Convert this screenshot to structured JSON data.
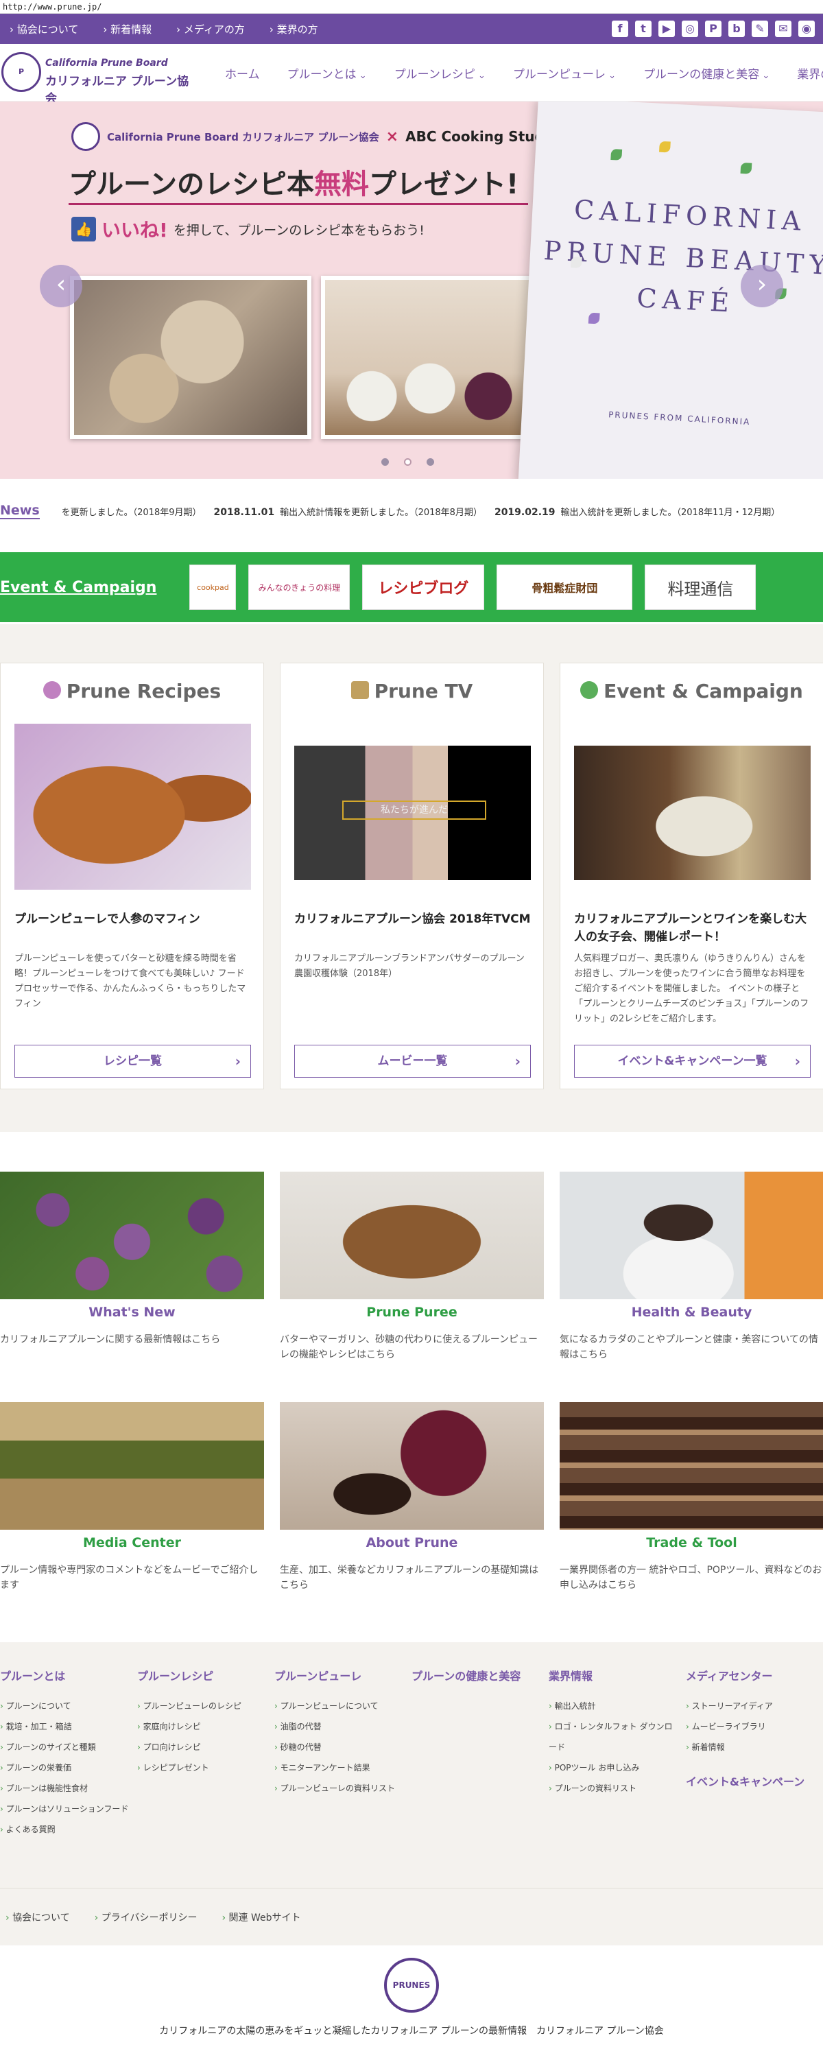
{
  "browser": {
    "url": "http://www.prune.jp/"
  },
  "topbar": {
    "links": [
      "協会について",
      "新着情報",
      "メディアの方",
      "業界の方"
    ],
    "social_icons": [
      "facebook-icon",
      "twitter-icon",
      "youtube-icon",
      "instagram-icon",
      "pinterest-icon",
      "blog-icon",
      "pen-icon",
      "mail-icon",
      "rss-icon"
    ]
  },
  "header": {
    "logo_line1": "California Prune Board",
    "logo_line2": "カリフォルニア プルーン協会",
    "nav": [
      {
        "label": "ホーム",
        "dropdown": false
      },
      {
        "label": "プルーンとは",
        "dropdown": true
      },
      {
        "label": "プルーンレシピ",
        "dropdown": true
      },
      {
        "label": "プルーンピューレ",
        "dropdown": true
      },
      {
        "label": "プルーンの健康と美容",
        "dropdown": true
      },
      {
        "label": "業界の方",
        "dropdown": true
      }
    ]
  },
  "hero": {
    "brand_left": "California Prune Board カリフォルニア プルーン協会",
    "brand_x": "×",
    "brand_right": "ABC Cooking Studio",
    "title_pre": "プルーンのレシピ本",
    "title_hl": "無料",
    "title_post": "プレゼント!",
    "sub_hl": "いいね!",
    "sub_rest": "を押して、プルーンのレシピ本をもらおう!",
    "book_title": "CALIFORNIA PRUNE BEAUTY CAFÉ",
    "book_footer": "PRUNES FROM CALIFORNIA",
    "slide_count": 3,
    "active_slide": 2,
    "accent": "#c83c7c"
  },
  "news": {
    "label": "News",
    "items": [
      {
        "date": "",
        "text": "を更新しました。（2018年9月期）"
      },
      {
        "date": "2018.11.01",
        "text": "輸出入統計情報を更新しました。（2018年8月期）"
      },
      {
        "date": "2019.02.19",
        "text": "輸出入統計を更新しました。（2018年11月・12月期）"
      }
    ]
  },
  "event_strip": {
    "label": "Event & Campaign",
    "banners": [
      "cookpad",
      "みんなのきょうの料理",
      "レシピブログ",
      "骨粗鬆症財団",
      "料理通信"
    ],
    "color": "#2fae48"
  },
  "cards": [
    {
      "heading": "Prune Recipes",
      "title": "プルーンピューレで人参のマフィン",
      "desc": "プルーンピューレを使ってバターと砂糖を練る時間を省略！プルーンピューレをつけて食べても美味しい♪ フードプロセッサーで作る、かんたんふっくら・もっちりしたマフィン",
      "button": "レシピ一覧"
    },
    {
      "heading": "Prune TV",
      "title": "カリフォルニアプルーン協会 2018年TVCM",
      "desc": "カリフォルニアプルーンブランドアンバサダーのプルーン農園収穫体験（2018年）",
      "video_caption": "私たちが進んだ",
      "button": "ムービー一覧"
    },
    {
      "heading": "Event & Campaign",
      "title": "カリフォルニアプルーンとワインを楽しむ大人の女子会、開催レポート！",
      "desc": "人気料理ブロガー、奥氏凛りん（ゆうきりんりん）さんをお招きし、プルーンを使ったワインに合う簡単なお料理をご紹介するイベントを開催しました。 イベントの様子と「プルーンとクリームチーズのピンチョス」「プルーンのフリット」の2レシピをご紹介します。",
      "button": "イベント&キャンペーン一覧"
    }
  ],
  "tiles": [
    {
      "title": "What's New",
      "desc": "カリフォルニアプルーンに関する最新情報はこちら",
      "color": "#7a5aa8"
    },
    {
      "title": "Prune Puree",
      "desc": "バターやマーガリン、砂糖の代わりに使えるプルーンピューレの機能やレシピはこちら",
      "color": "#2e9e44"
    },
    {
      "title": "Health & Beauty",
      "desc": "気になるカラダのことやプルーンと健康・美容についての情報はこちら",
      "color": "#7a5aa8"
    },
    {
      "title": "Media Center",
      "desc": "プルーン情報や専門家のコメントなどをムービーでご紹介します",
      "color": "#2e9e44"
    },
    {
      "title": "About Prune",
      "desc": "生産、加工、栄養などカリフォルニアプルーンの基礎知識はこちら",
      "color": "#7a5aa8"
    },
    {
      "title": "Trade & Tool",
      "desc": "一業界関係者の方一 統計やロゴ、POPツール、資料などのお申し込みはこちら",
      "color": "#2e9e44"
    }
  ],
  "footer": {
    "columns": [
      {
        "heading": "プルーンとは",
        "items": [
          "プルーンについて",
          "栽培・加工・箱詰",
          "プルーンのサイズと種類",
          "プルーンの栄養価",
          "プルーンは機能性食材",
          "プルーンはソリューションフード",
          "よくある質問"
        ]
      },
      {
        "heading": "プルーンレシピ",
        "items": [
          "プルーンピューレのレシピ",
          "家庭向けレシピ",
          "プロ向けレシピ",
          "レシピプレゼント"
        ]
      },
      {
        "heading": "プルーンピューレ",
        "items": [
          "プルーンピューレについて",
          "油脂の代替",
          "砂糖の代替",
          "モニターアンケート結果",
          "プルーンピューレの資料リスト"
        ]
      },
      {
        "heading": "プルーンの健康と美容",
        "items": []
      },
      {
        "heading": "業界情報",
        "items": [
          "輸出入統計",
          "ロゴ・レンタルフォト ダウンロード",
          "POPツール お申し込み",
          "プルーンの資料リスト"
        ]
      },
      {
        "heading": "メディアセンター",
        "items": [
          "ストーリーアイディア",
          "ムービーライブラリ",
          "新着情報"
        ],
        "extra_heading": "イベント&キャンペーン"
      }
    ],
    "bottom_links": [
      "協会について",
      "プライバシーポリシー",
      "関連 Webサイト"
    ],
    "logo_text": "PRUNES",
    "copyright": "カリフォルニアの太陽の恵みをギュッと凝縮したカリフォルニア プルーンの最新情報　カリフォルニア プルーン協会"
  },
  "colors": {
    "brand_purple": "#6b4ba0",
    "green": "#2fae48"
  }
}
